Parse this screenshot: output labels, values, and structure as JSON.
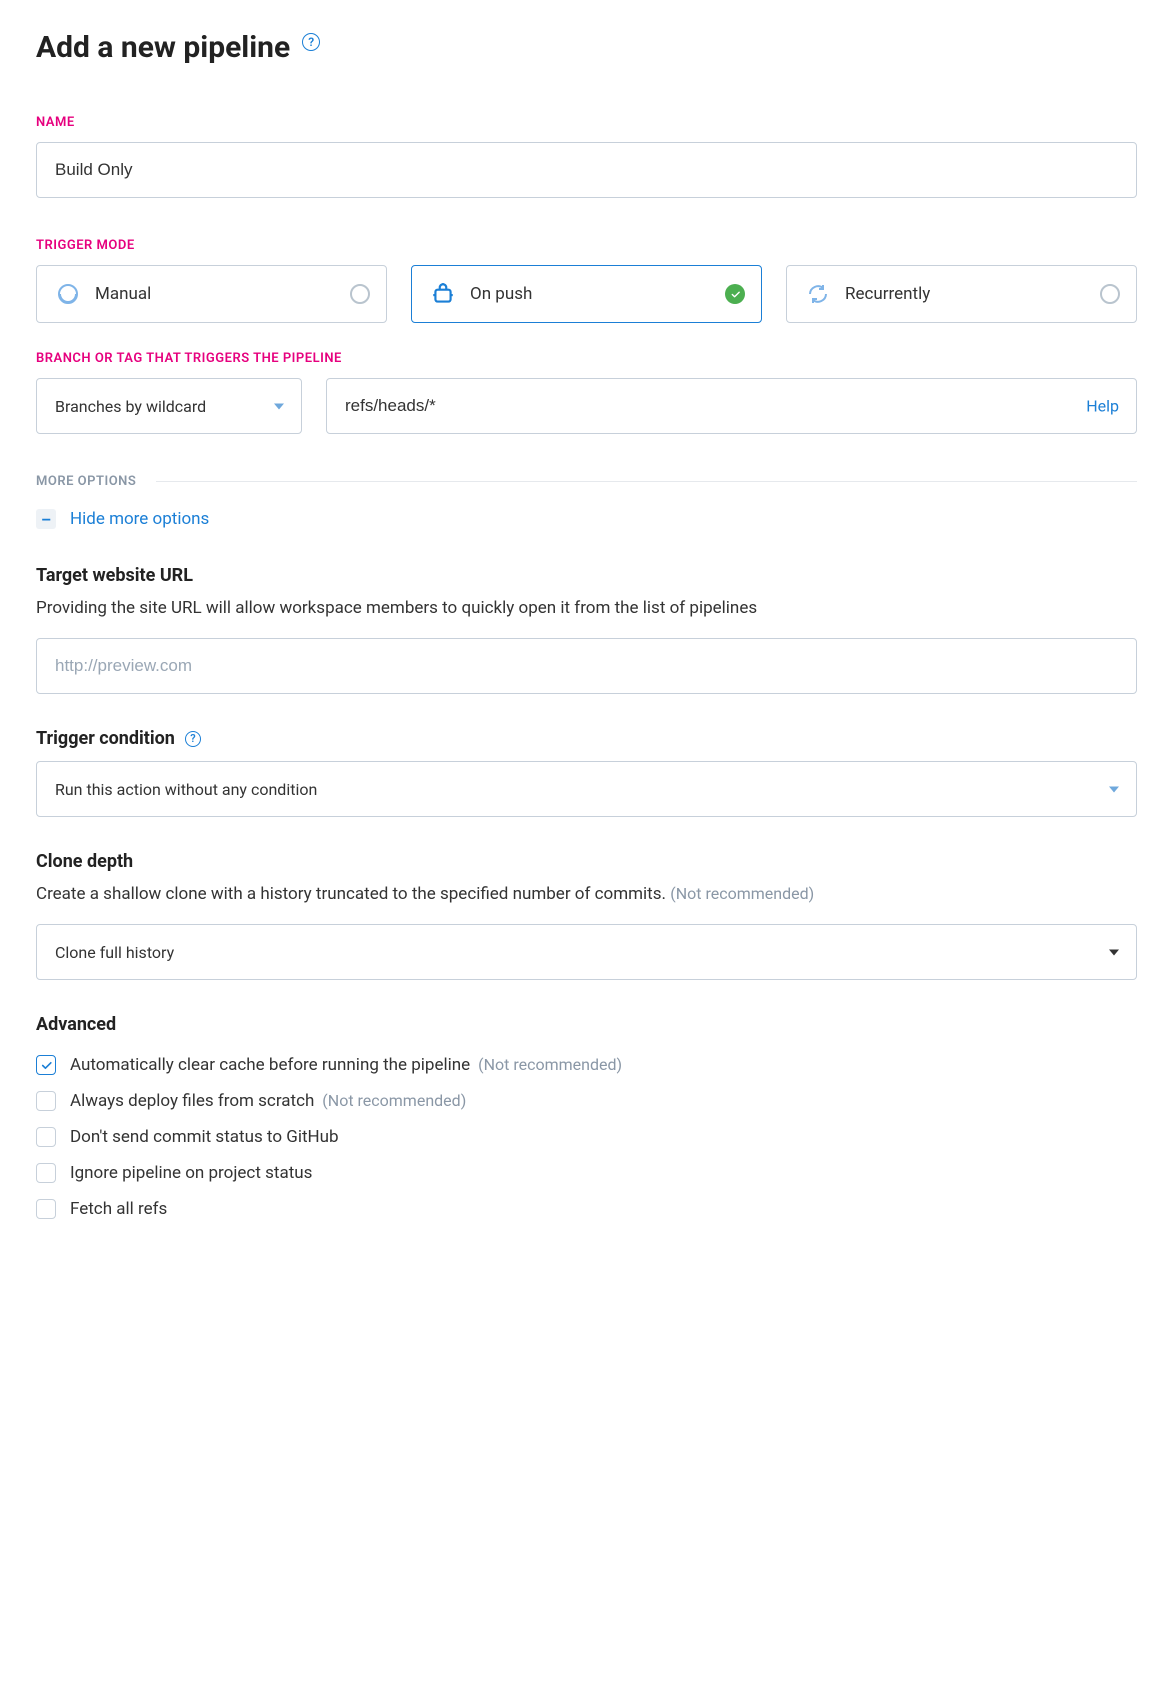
{
  "header": {
    "title": "Add a new pipeline"
  },
  "name": {
    "label": "NAME",
    "value": "Build Only"
  },
  "trigger": {
    "label": "TRIGGER MODE",
    "options": {
      "manual": "Manual",
      "onpush": "On push",
      "recurrently": "Recurrently"
    },
    "selected": "onpush"
  },
  "branch": {
    "label": "BRANCH OR TAG THAT TRIGGERS THE PIPELINE",
    "select_value": "Branches by wildcard",
    "input_value": "refs/heads/*",
    "help": "Help"
  },
  "more": {
    "label": "MORE OPTIONS",
    "toggle": "Hide more options"
  },
  "target_url": {
    "heading": "Target website URL",
    "desc": "Providing the site URL will allow workspace members to quickly open it from the list of pipelines",
    "placeholder": "http://preview.com"
  },
  "trigger_cond": {
    "heading": "Trigger condition",
    "value": "Run this action without any condition"
  },
  "clone": {
    "heading": "Clone depth",
    "desc": "Create a shallow clone with a history truncated to the specified number of commits. ",
    "note": "(Not recommended)",
    "value": "Clone full history"
  },
  "advanced": {
    "heading": "Advanced",
    "items": [
      {
        "label": "Automatically clear cache before running the pipeline",
        "note": "(Not recommended)",
        "checked": true
      },
      {
        "label": "Always deploy files from scratch",
        "note": "(Not recommended)",
        "checked": false
      },
      {
        "label": "Don't send commit status to GitHub",
        "note": "",
        "checked": false
      },
      {
        "label": "Ignore pipeline on project status",
        "note": "",
        "checked": false
      },
      {
        "label": "Fetch all refs",
        "note": "",
        "checked": false
      }
    ]
  }
}
